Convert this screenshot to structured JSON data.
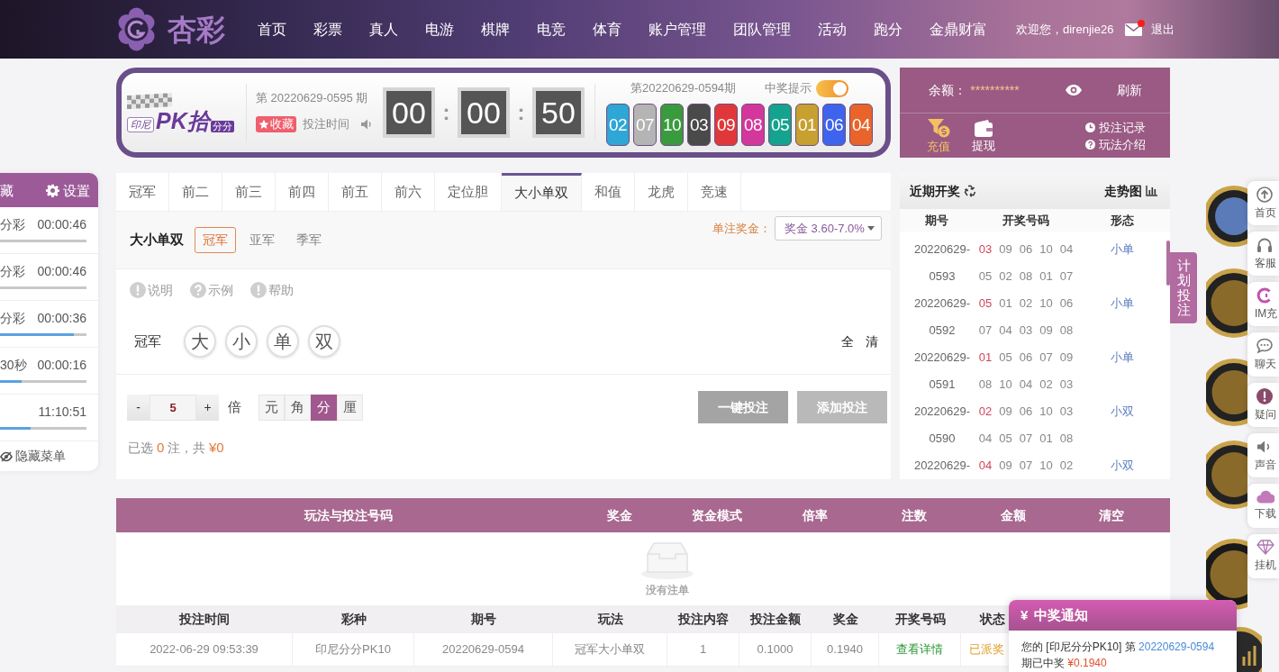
{
  "header": {
    "logo_text": "杏彩",
    "nav": [
      {
        "label": "首页"
      },
      {
        "label": "彩票"
      },
      {
        "label": "真人"
      },
      {
        "label": "电游"
      },
      {
        "label": "棋牌"
      },
      {
        "label": "电竞"
      },
      {
        "label": "体育"
      },
      {
        "label": "账户管理"
      },
      {
        "label": "团队管理"
      },
      {
        "label": "活动"
      },
      {
        "label": "跑分"
      },
      {
        "label": "金鼎财富"
      }
    ],
    "welcome": "欢迎您，direnjie26",
    "mail_unread": true,
    "logout": "退出"
  },
  "sidebar": {
    "title": "藏",
    "settings": "设置",
    "items": [
      {
        "name": "分彩",
        "time": "00:00:46"
      },
      {
        "name": "分彩",
        "time": "00:00:46"
      },
      {
        "name": "分彩",
        "time": "00:00:36",
        "level": 0.85
      },
      {
        "name": "30秒",
        "time": "00:00:16",
        "level": 0.25
      },
      {
        "time": "11:10:51",
        "level": 0.35
      }
    ],
    "hide_menu": "隐藏菜单"
  },
  "lottery": {
    "logo": {
      "region": "印尼",
      "name": "PK拾",
      "mode": "分分"
    },
    "current_issue": "第 20220629-0595 期",
    "favorite": "收藏",
    "bet_time_label": "投注时间",
    "countdown": {
      "parts": [
        "00",
        "00",
        "50"
      ],
      "separator": ":"
    },
    "last_issue": "第20220629-0594期",
    "win_alert": {
      "label": "中奖提示",
      "on": true
    },
    "balls": [
      {
        "number": "02",
        "color": "#2ea6d6"
      },
      {
        "number": "07",
        "color": "#b4b4b4"
      },
      {
        "number": "10",
        "color": "#3a9a3e"
      },
      {
        "number": "03",
        "color": "#4a4a4a"
      },
      {
        "number": "09",
        "color": "#e0383a"
      },
      {
        "number": "08",
        "color": "#d4379c"
      },
      {
        "number": "05",
        "color": "#14a38e"
      },
      {
        "number": "01",
        "color": "#c8a030"
      },
      {
        "number": "06",
        "color": "#3e64ee"
      },
      {
        "number": "04",
        "color": "#e8642a"
      }
    ]
  },
  "balance": {
    "label": "余额：",
    "value": "**********",
    "refresh": "刷新",
    "actions": [
      {
        "label": "充值",
        "kind": "deposit",
        "selected": true
      },
      {
        "label": "提现",
        "kind": "withdraw",
        "selected": false
      }
    ],
    "links": [
      {
        "label": "投注记录",
        "kind": "history"
      },
      {
        "label": "玩法介绍",
        "kind": "guide"
      }
    ]
  },
  "bet": {
    "tabs": [
      {
        "label": "冠军",
        "selected": false
      },
      {
        "label": "前二",
        "selected": false
      },
      {
        "label": "前三",
        "selected": false
      },
      {
        "label": "前四",
        "selected": false
      },
      {
        "label": "前五",
        "selected": false
      },
      {
        "label": "前六",
        "selected": false
      },
      {
        "label": "定位胆",
        "selected": false
      },
      {
        "label": "大小单双",
        "selected": true
      },
      {
        "label": "和值",
        "selected": false
      },
      {
        "label": "龙虎",
        "selected": false
      },
      {
        "label": "竞速",
        "selected": false
      }
    ],
    "play_title": "大小单双",
    "positions": [
      {
        "label": "冠军",
        "selected": true
      },
      {
        "label": "亚军",
        "selected": false
      },
      {
        "label": "季军",
        "selected": false
      }
    ],
    "prize_label": "单注奖金：",
    "prize_select": "奖金 3.60-7.0%",
    "help_links": [
      {
        "label": "说明",
        "kind": "info"
      },
      {
        "label": "示例",
        "kind": "example"
      },
      {
        "label": "帮助",
        "kind": "info"
      }
    ],
    "row_label": "冠军",
    "options": [
      {
        "label": "大",
        "selected": false
      },
      {
        "label": "小",
        "selected": false
      },
      {
        "label": "单",
        "selected": false
      },
      {
        "label": "双",
        "selected": false
      }
    ],
    "quick": [
      "全",
      "清"
    ],
    "multiplier": {
      "minus": "-",
      "value": "5",
      "plus": "+",
      "unit": "倍"
    },
    "currency_units": [
      {
        "label": "元",
        "selected": false
      },
      {
        "label": "角",
        "selected": false
      },
      {
        "label": "分",
        "selected": true
      },
      {
        "label": "厘",
        "selected": false
      }
    ],
    "buttons": [
      {
        "label": "一键投注",
        "kind": "quick"
      },
      {
        "label": "添加投注",
        "kind": "add"
      }
    ],
    "summary": [
      {
        "text": "已选 ",
        "kind": "plain"
      },
      {
        "text": "0",
        "kind": "value"
      },
      {
        "text": " 注，共 ",
        "kind": "plain"
      },
      {
        "text": "¥0",
        "kind": "value"
      }
    ]
  },
  "recent": {
    "title": "近期开奖",
    "trend": "走势图",
    "columns": [
      "期号",
      "开奖号码",
      "形态"
    ],
    "rows": [
      {
        "issue": [
          "20220629-",
          "0593"
        ],
        "numbers": [
          [
            "03",
            "09",
            "06",
            "10",
            "04"
          ],
          [
            "05",
            "02",
            "08",
            "01",
            "07"
          ]
        ],
        "pattern": "小单"
      },
      {
        "issue": [
          "20220629-",
          "0592"
        ],
        "numbers": [
          [
            "05",
            "01",
            "02",
            "10",
            "06"
          ],
          [
            "07",
            "04",
            "03",
            "09",
            "08"
          ]
        ],
        "pattern": "小单"
      },
      {
        "issue": [
          "20220629-",
          "0591"
        ],
        "numbers": [
          [
            "01",
            "05",
            "06",
            "07",
            "09"
          ],
          [
            "08",
            "10",
            "04",
            "02",
            "03"
          ]
        ],
        "pattern": "小单"
      },
      {
        "issue": [
          "20220629-",
          "0590"
        ],
        "numbers": [
          [
            "02",
            "09",
            "06",
            "10",
            "03"
          ],
          [
            "04",
            "05",
            "07",
            "01",
            "08"
          ]
        ],
        "pattern": "小双"
      },
      {
        "issue": [
          "20220629-"
        ],
        "numbers": [
          [
            "04",
            "09",
            "07",
            "10",
            "02"
          ]
        ],
        "pattern": "小双"
      }
    ]
  },
  "plan_tab": "计划投注",
  "side_tools": [
    {
      "label": "首页",
      "kind": "home"
    },
    {
      "label": "客服",
      "kind": "support"
    },
    {
      "label": "IM充",
      "kind": "im"
    },
    {
      "label": "聊天",
      "kind": "chat"
    },
    {
      "label": "疑问",
      "kind": "question"
    },
    {
      "label": "声音",
      "kind": "sound"
    },
    {
      "label": "下载",
      "kind": "download"
    },
    {
      "label": "挂机",
      "kind": "diamond"
    }
  ],
  "cart": {
    "columns": [
      "玩法与投注号码",
      "奖金",
      "资金模式",
      "倍率",
      "注数",
      "金额",
      "清空"
    ],
    "empty_text": "没有注单"
  },
  "history": {
    "columns": [
      "投注时间",
      "彩种",
      "期号",
      "玩法",
      "投注内容",
      "投注金额",
      "奖金",
      "开奖号码",
      "状态"
    ],
    "rows": [
      {
        "cells": [
          {
            "text": "2022-06-29 09:53:39",
            "kind": "plain"
          },
          {
            "text": "印尼分分PK10",
            "kind": "plain"
          },
          {
            "text": "20220629-0594",
            "kind": "plain"
          },
          {
            "text": "冠军大小单双",
            "kind": "plain"
          },
          {
            "text": "1",
            "kind": "plain"
          },
          {
            "text": "0.1000",
            "kind": "plain"
          },
          {
            "text": "0.1940",
            "kind": "plain"
          },
          {
            "text": "查看详情",
            "kind": "link"
          },
          {
            "text": "已派奖",
            "kind": "status"
          }
        ]
      }
    ]
  },
  "notification": {
    "symbol": "¥",
    "title": "中奖通知",
    "message": [
      {
        "text": "您的 [印尼分分PK10] 第 ",
        "kind": "plain"
      },
      {
        "text": "20220629-0594",
        "kind": "issue"
      },
      {
        "text": " 期已中奖 ",
        "kind": "plain"
      },
      {
        "text": "¥0.1940",
        "kind": "amount"
      }
    ]
  }
}
